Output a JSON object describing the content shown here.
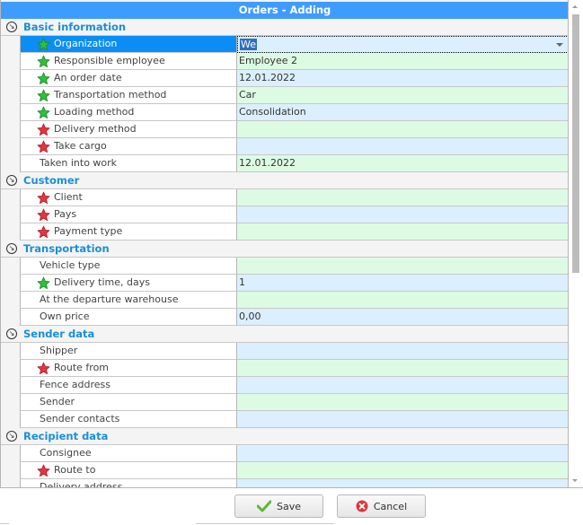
{
  "window": {
    "title": "Orders - Adding"
  },
  "colors": {
    "title_bar": "#3e9cff",
    "group_title": "#1a8fd6",
    "selected_row": "#0a8ef5",
    "value_blue": "#dbefff",
    "value_green": "#ddfbe3",
    "required_star": "#e8343e",
    "filled_star": "#2fbf3a"
  },
  "groups": [
    {
      "title": "Basic information",
      "rows": [
        {
          "label": "Organization",
          "value": "We",
          "star": "green",
          "bg": "blue",
          "selected": true,
          "dropdown": true
        },
        {
          "label": "Responsible employee",
          "value": "Employee 2",
          "star": "green",
          "bg": "green"
        },
        {
          "label": "An order date",
          "value": "12.01.2022",
          "star": "green",
          "bg": "blue"
        },
        {
          "label": "Transportation method",
          "value": "Car",
          "star": "green",
          "bg": "green"
        },
        {
          "label": "Loading method",
          "value": "Consolidation",
          "star": "green",
          "bg": "blue"
        },
        {
          "label": "Delivery method",
          "value": "",
          "star": "red",
          "bg": "green"
        },
        {
          "label": "Take cargo",
          "value": "",
          "star": "red",
          "bg": "blue"
        },
        {
          "label": "Taken into work",
          "value": "12.01.2022",
          "star": "none",
          "bg": "green"
        }
      ]
    },
    {
      "title": "Customer",
      "rows": [
        {
          "label": "Client",
          "value": "",
          "star": "red",
          "bg": "green"
        },
        {
          "label": "Pays",
          "value": "",
          "star": "red",
          "bg": "blue"
        },
        {
          "label": "Payment type",
          "value": "",
          "star": "red",
          "bg": "green"
        }
      ]
    },
    {
      "title": "Transportation",
      "rows": [
        {
          "label": "Vehicle type",
          "value": "",
          "star": "none",
          "bg": "green"
        },
        {
          "label": "Delivery time, days",
          "value": "1",
          "star": "green",
          "bg": "blue"
        },
        {
          "label": "At the departure warehouse",
          "value": "",
          "star": "none",
          "bg": "green"
        },
        {
          "label": "Own price",
          "value": "0,00",
          "star": "none",
          "bg": "blue"
        }
      ]
    },
    {
      "title": "Sender data",
      "rows": [
        {
          "label": "Shipper",
          "value": "",
          "star": "none",
          "bg": "blue"
        },
        {
          "label": "Route from",
          "value": "",
          "star": "red",
          "bg": "green"
        },
        {
          "label": "Fence address",
          "value": "",
          "star": "none",
          "bg": "blue"
        },
        {
          "label": "Sender",
          "value": "",
          "star": "none",
          "bg": "green"
        },
        {
          "label": "Sender contacts",
          "value": "",
          "star": "none",
          "bg": "blue"
        }
      ]
    },
    {
      "title": "Recipient data",
      "rows": [
        {
          "label": "Consignee",
          "value": "",
          "star": "none",
          "bg": "blue"
        },
        {
          "label": "Route to",
          "value": "",
          "star": "red",
          "bg": "green"
        },
        {
          "label": "Delivery address",
          "value": "",
          "star": "none",
          "bg": "blue"
        }
      ]
    }
  ],
  "buttons": {
    "save": {
      "label": "Save",
      "icon": "check-icon"
    },
    "cancel": {
      "label": "Cancel",
      "icon": "cancel-circle-icon"
    }
  }
}
